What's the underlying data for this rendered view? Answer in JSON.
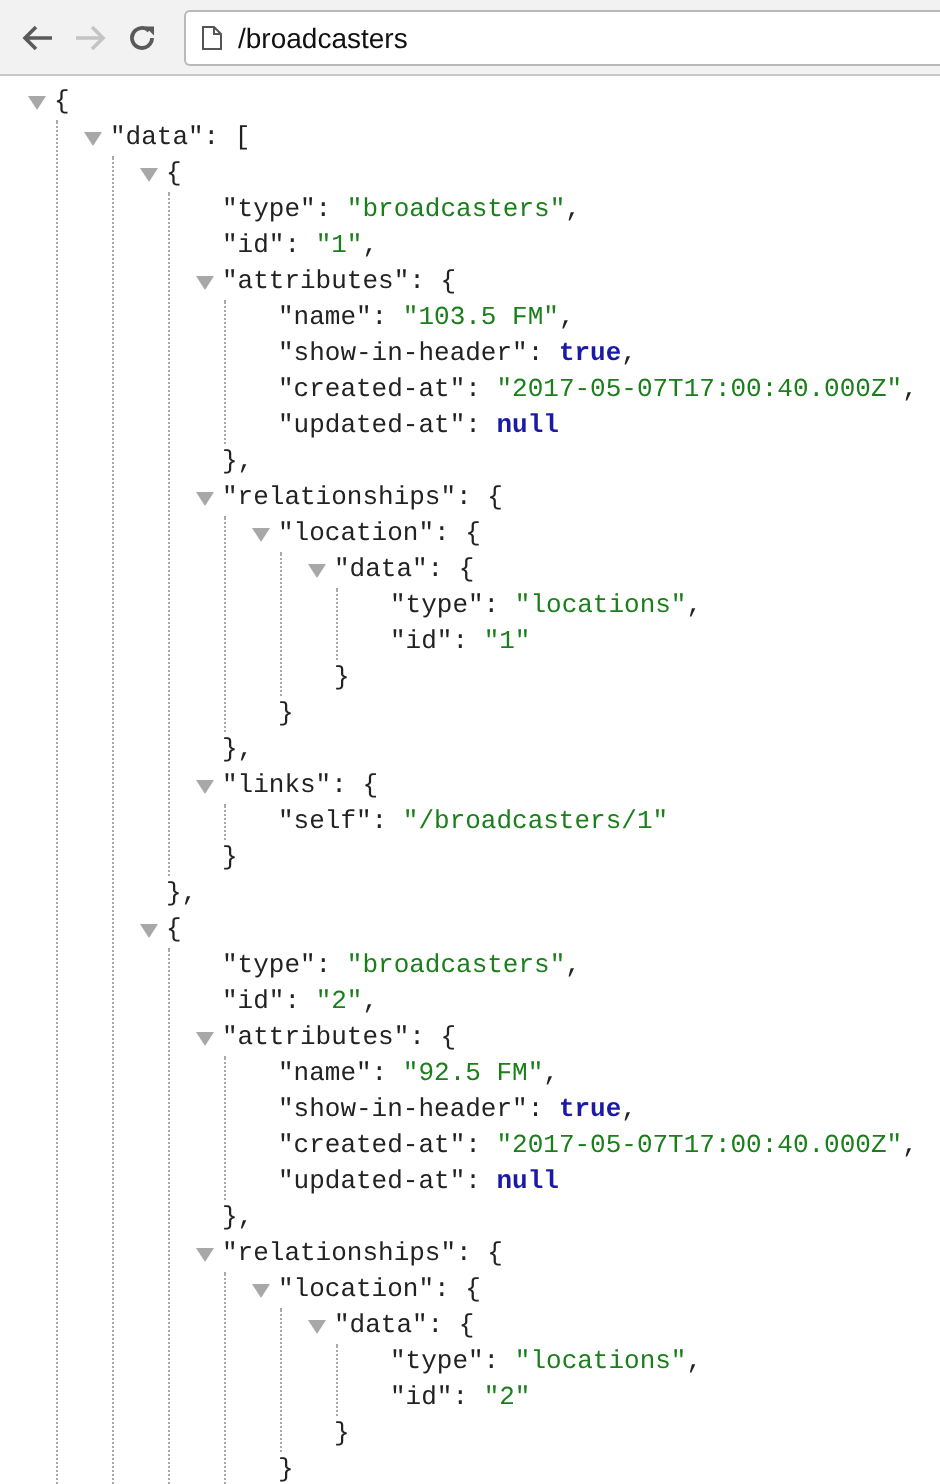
{
  "toolbar": {
    "back": {
      "disabled": false
    },
    "forward": {
      "disabled": true
    },
    "address": "/broadcasters"
  },
  "tree": {
    "open": "{",
    "expanded": true,
    "children": [
      {
        "key": "\"data\":",
        "open": "[",
        "expanded": true,
        "children": [
          {
            "open": "{",
            "expanded": true,
            "close": "},",
            "children": [
              {
                "key": "\"type\":",
                "value": "\"broadcasters\"",
                "kind": "string",
                "tail": ","
              },
              {
                "key": "\"id\":",
                "value": "\"1\"",
                "kind": "string",
                "tail": ","
              },
              {
                "key": "\"attributes\":",
                "open": "{",
                "expanded": true,
                "close": "},",
                "children": [
                  {
                    "key": "\"name\":",
                    "value": "\"103.5 FM\"",
                    "kind": "string",
                    "tail": ","
                  },
                  {
                    "key": "\"show-in-header\":",
                    "value": "true",
                    "kind": "literal",
                    "tail": ","
                  },
                  {
                    "key": "\"created-at\":",
                    "value": "\"2017-05-07T17:00:40.000Z\"",
                    "kind": "string",
                    "tail": ","
                  },
                  {
                    "key": "\"updated-at\":",
                    "value": "null",
                    "kind": "literal"
                  }
                ]
              },
              {
                "key": "\"relationships\":",
                "open": "{",
                "expanded": true,
                "close": "},",
                "children": [
                  {
                    "key": "\"location\":",
                    "open": "{",
                    "expanded": true,
                    "close": "}",
                    "children": [
                      {
                        "key": "\"data\":",
                        "open": "{",
                        "expanded": true,
                        "close": "}",
                        "children": [
                          {
                            "key": "\"type\":",
                            "value": "\"locations\"",
                            "kind": "string",
                            "tail": ","
                          },
                          {
                            "key": "\"id\":",
                            "value": "\"1\"",
                            "kind": "string"
                          }
                        ]
                      }
                    ]
                  }
                ]
              },
              {
                "key": "\"links\":",
                "open": "{",
                "expanded": true,
                "close": "}",
                "children": [
                  {
                    "key": "\"self\":",
                    "value": "\"/broadcasters/1\"",
                    "kind": "string"
                  }
                ]
              }
            ]
          },
          {
            "open": "{",
            "expanded": true,
            "children": [
              {
                "key": "\"type\":",
                "value": "\"broadcasters\"",
                "kind": "string",
                "tail": ","
              },
              {
                "key": "\"id\":",
                "value": "\"2\"",
                "kind": "string",
                "tail": ","
              },
              {
                "key": "\"attributes\":",
                "open": "{",
                "expanded": true,
                "close": "},",
                "children": [
                  {
                    "key": "\"name\":",
                    "value": "\"92.5 FM\"",
                    "kind": "string",
                    "tail": ","
                  },
                  {
                    "key": "\"show-in-header\":",
                    "value": "true",
                    "kind": "literal",
                    "tail": ","
                  },
                  {
                    "key": "\"created-at\":",
                    "value": "\"2017-05-07T17:00:40.000Z\"",
                    "kind": "string",
                    "tail": ","
                  },
                  {
                    "key": "\"updated-at\":",
                    "value": "null",
                    "kind": "literal"
                  }
                ]
              },
              {
                "key": "\"relationships\":",
                "open": "{",
                "expanded": true,
                "children": [
                  {
                    "key": "\"location\":",
                    "open": "{",
                    "expanded": true,
                    "close": "}",
                    "children": [
                      {
                        "key": "\"data\":",
                        "open": "{",
                        "expanded": true,
                        "close": "}",
                        "children": [
                          {
                            "key": "\"type\":",
                            "value": "\"locations\"",
                            "kind": "string",
                            "tail": ","
                          },
                          {
                            "key": "\"id\":",
                            "value": "\"2\"",
                            "kind": "string"
                          }
                        ]
                      }
                    ]
                  }
                ]
              }
            ]
          }
        ]
      }
    ]
  }
}
